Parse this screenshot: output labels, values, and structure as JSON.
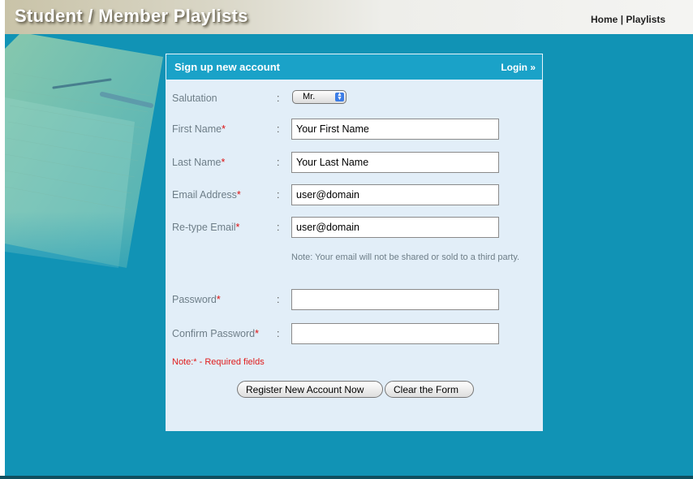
{
  "header": {
    "site_title": "Student / Member Playlists",
    "nav": {
      "home": "Home",
      "separator": "|",
      "playlists": "Playlists"
    }
  },
  "panel": {
    "title": "Sign up new account",
    "login_label": "Login »",
    "fields": {
      "salutation": {
        "label": "Salutation",
        "value": "Mr.",
        "required": false
      },
      "first_name": {
        "label": "First Name",
        "value": "Your First Name",
        "required": true
      },
      "last_name": {
        "label": "Last Name",
        "value": "Your Last Name",
        "required": true
      },
      "email": {
        "label": "Email Address",
        "value": "user@domain",
        "required": true
      },
      "retype_email": {
        "label": "Re-type Email",
        "value": "user@domain",
        "required": true
      },
      "password": {
        "label": "Password",
        "value": "",
        "required": true
      },
      "confirm_password": {
        "label": "Confirm Password",
        "value": "",
        "required": true
      }
    },
    "colon": ":",
    "required_mark": "*",
    "email_note": "Note: Your email will not be shared or sold to a third party.",
    "required_note": "Note:* - Required fields",
    "buttons": {
      "register": "Register New Account Now",
      "clear": "Clear the Form"
    }
  },
  "colors": {
    "background": "#1193b5",
    "panel_header": "#1aa2c8",
    "panel_body": "#e2eef8",
    "required": "#e01b1b"
  },
  "icons": {
    "select_arrows": "up-down-arrows-icon"
  }
}
